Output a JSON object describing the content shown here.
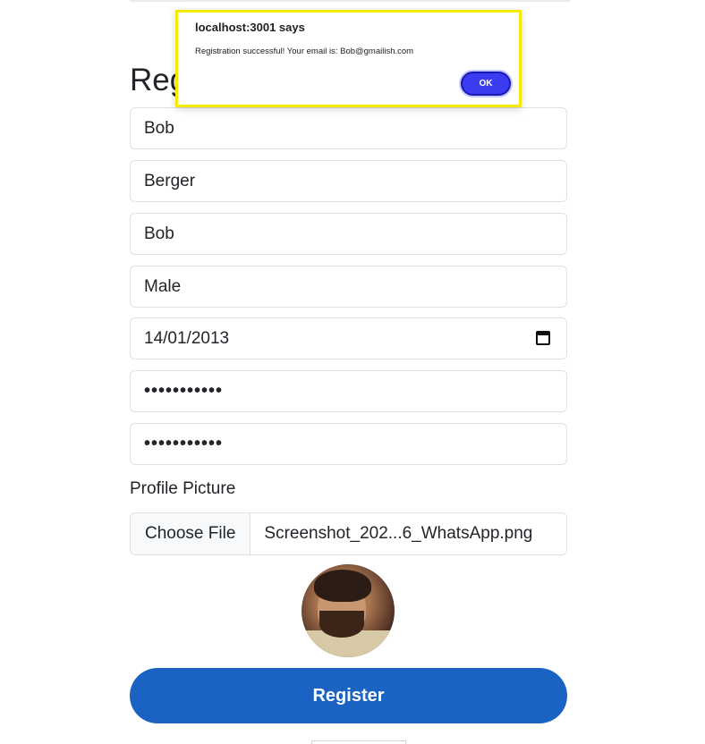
{
  "form": {
    "title": "Reg",
    "first_name": "Bob",
    "last_name": "Berger",
    "username": "Bob",
    "gender": "Male",
    "dob": "14/01/2013",
    "password": "•••••••••••",
    "confirm_password": "•••••••••••",
    "profile_label": "Profile Picture",
    "choose_file_label": "Choose File",
    "file_name": "Screenshot_202...6_WhatsApp.png",
    "register_label": "Register"
  },
  "dialog": {
    "title": "localhost:3001 says",
    "message": "Registration successful! Your email is: Bob@gmailish.com",
    "ok_label": "OK"
  },
  "colors": {
    "primary_button": "#1b63c2",
    "dialog_ok": "#3b3bf0",
    "dialog_highlight": "#f5ea00"
  }
}
